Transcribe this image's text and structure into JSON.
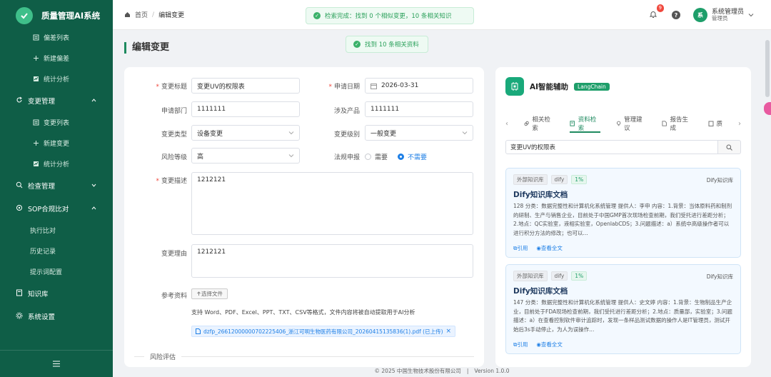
{
  "app": {
    "title": "质量管理AI系统"
  },
  "sidebar": {
    "items": [
      {
        "label": "偏差列表",
        "icon": "list-icon",
        "kind": "sub"
      },
      {
        "label": "新建偏差",
        "icon": "plus-icon",
        "kind": "sub"
      },
      {
        "label": "统计分析",
        "icon": "chart-icon",
        "kind": "sub"
      },
      {
        "label": "变更管理",
        "icon": "refresh-icon",
        "kind": "group"
      },
      {
        "label": "变更列表",
        "icon": "list-icon",
        "kind": "sub"
      },
      {
        "label": "新建变更",
        "icon": "plus-icon",
        "kind": "sub"
      },
      {
        "label": "统计分析",
        "icon": "chart-icon",
        "kind": "sub"
      },
      {
        "label": "检查管理",
        "icon": "search-icon",
        "kind": "group"
      },
      {
        "label": "SOP合规比对",
        "icon": "target-icon",
        "kind": "group"
      },
      {
        "label": "执行比对",
        "kind": "plain"
      },
      {
        "label": "历史记录",
        "kind": "plain"
      },
      {
        "label": "提示词配置",
        "kind": "plain"
      },
      {
        "label": "知识库",
        "icon": "book-icon",
        "kind": "group"
      },
      {
        "label": "系统设置",
        "icon": "gear-icon",
        "kind": "group"
      }
    ]
  },
  "header": {
    "breadcrumb": {
      "home": "首页",
      "sep": "/",
      "current": "编辑变更"
    },
    "bell_count": "9",
    "help": "?",
    "user": {
      "avatar": "系",
      "name": "系统管理员",
      "role": "管理员"
    }
  },
  "toasts": {
    "top": "检索完成：找到 0 个相似变更，10 条相关知识",
    "second": "找到 10 条相关资料"
  },
  "page_title": "编辑变更",
  "form": {
    "title_label": "变更标题",
    "title_value": "变更UV的权限表",
    "date_label": "申请日期",
    "date_value": "2026-03-31",
    "dept_label": "申请部门",
    "dept_value": "1111111",
    "product_label": "涉及产品",
    "product_value": "1111111",
    "type_label": "变更类型",
    "type_value": "设备变更",
    "level_label": "变更级别",
    "level_value": "一般变更",
    "risk_label": "风险等级",
    "risk_value": "高",
    "reg_label": "法规申报",
    "reg_opt_yes": "需要",
    "reg_opt_no": "不需要",
    "desc_label": "变更描述",
    "desc_value": "1212121",
    "reason_label": "变更理由",
    "reason_value": "1212121",
    "ref_label": "参考资料",
    "upload_label": "选择文件",
    "upload_hint": "支持 Word、PDF、Excel、PPT、TXT、CSV等格式，文件内容将被自动提取用于AI分析",
    "file_name": "dzfp_26612000000702225406_浙江可明生物医药有限公司_20260415135836(1).pdf (已上传)",
    "section_risk": "风险评估"
  },
  "ai": {
    "title": "AI智能辅助",
    "badge": "LangChain",
    "tabs": [
      "相关检索",
      "资料检索",
      "管理建议",
      "报告生成",
      "质"
    ],
    "active_tab": 1,
    "search_value": "变更UV的权限表",
    "results": [
      {
        "tag_src": "外部知识库",
        "tag_engine": "dify",
        "score": "1%",
        "source": "Dify知识库",
        "title": "Dify知识库文档",
        "body": "128 分类：数据完整性和计算机化系统管理 提供人：李申 内容：1.背景：当体原料药和制剂的研制、生产与销售企业，目前处于中国GMP首次现场检查前期，我们受托进行差距分析；2.地点：QC实验室，液相实验室，OpenlabCDS；3.问题描述：a）系统中高级操作者可以进行积分方法的修改；也可以...",
        "cite": "引用",
        "view": "查看全文"
      },
      {
        "tag_src": "外部知识库",
        "tag_engine": "dify",
        "score": "1%",
        "source": "Dify知识库",
        "title": "Dify知识库文档",
        "body": "147 分类：数据完整性和计算机化系统管理 提供人：史文婷 内容：1.背景：生物制品生产企业，目前处于FDA现场检查前期，我们受托进行差距分析；2.地点：质量部，实验室；3.问题描述：a）在查看控制软件审计追踪时，发现一条样品测试数据的操作人是IT管理员，测试开始后3s手动停止，为人为误操作...",
        "cite": "引用",
        "view": "查看全文"
      }
    ]
  },
  "footer": {
    "copyright": "© 2025 中国生物技术股份有限公司",
    "divider": "|",
    "version": "Version 1.0.0"
  },
  "colors": {
    "sidebar": "#0f5e47",
    "accent": "#1e8a5f",
    "link": "#1e7fe6"
  }
}
